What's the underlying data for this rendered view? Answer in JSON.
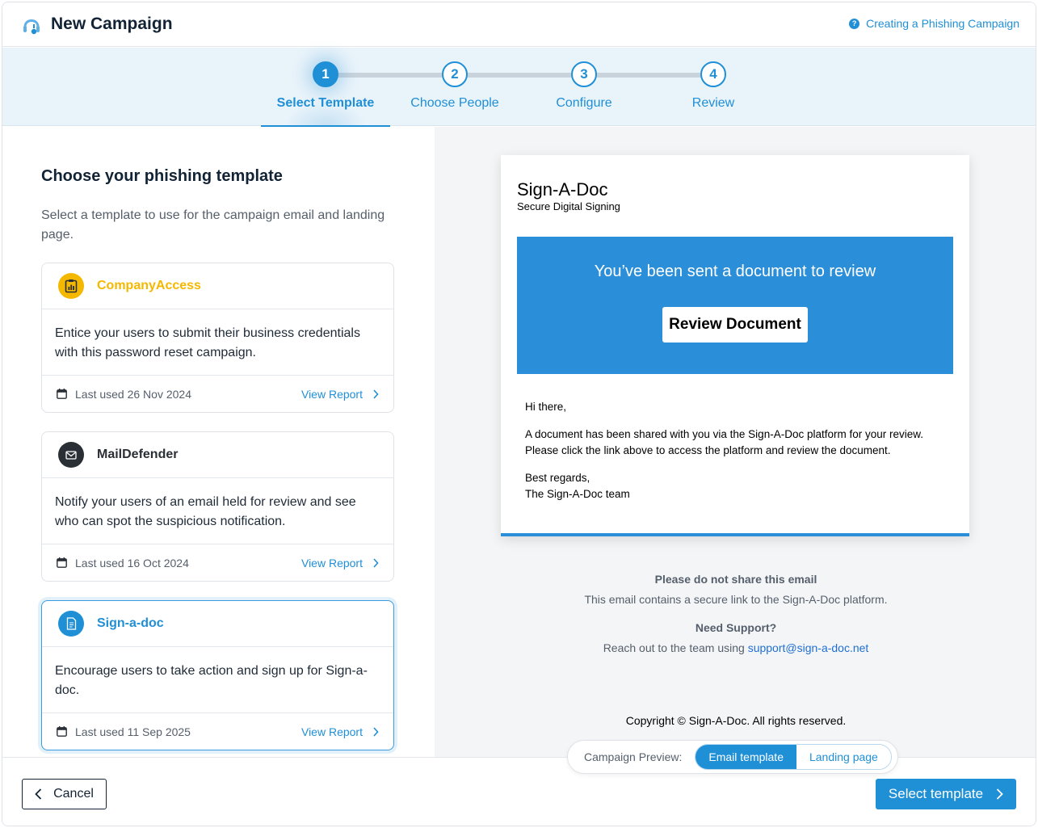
{
  "header": {
    "title": "New Campaign",
    "help_link": "Creating a Phishing Campaign",
    "help_icon_glyph": "?"
  },
  "stepper": {
    "steps": [
      {
        "number": "1",
        "label": "Select Template",
        "active": true
      },
      {
        "number": "2",
        "label": "Choose People",
        "active": false
      },
      {
        "number": "3",
        "label": "Configure",
        "active": false
      },
      {
        "number": "4",
        "label": "Review",
        "active": false
      }
    ]
  },
  "left": {
    "heading": "Choose your phishing template",
    "subtitle": "Select a template to use for the campaign email and landing page.",
    "templates": [
      {
        "name": "CompanyAccess",
        "icon": "clipboard-chart-icon",
        "color": "#f5b800",
        "description": "Entice your users to submit their business credentials with this password reset campaign.",
        "last_used": "Last used 26 Nov 2024",
        "view_report": "View Report"
      },
      {
        "name": "MailDefender",
        "icon": "envelope-icon",
        "color": "#2a2f36",
        "description": "Notify your users of an email held for review and see who can spot the suspicious notification.",
        "last_used": "Last used 16 Oct 2024",
        "view_report": "View Report"
      },
      {
        "name": "Sign-a-doc",
        "icon": "document-icon",
        "color": "#1f8fd6",
        "description": "Encourage users to take action and sign up for Sign-a-doc.",
        "last_used": "Last used 11 Sep 2025",
        "view_report": "View Report"
      }
    ]
  },
  "preview": {
    "brand_name": "Sign-A-Doc",
    "brand_tagline": "Secure Digital Signing",
    "banner_text": "You’ve been sent a document to review",
    "button_label": "Review Document",
    "greeting": "Hi there,",
    "body": "A document has been shared with you via the Sign-A-Doc platform for your review. Please click the link above to access the platform and review the document.",
    "signoff_1": "Best regards,",
    "signoff_2": "The Sign-A-Doc team",
    "notice_title": "Please do not share this email",
    "notice_text": "This email contains a secure link to the Sign-A-Doc platform.",
    "support_title": "Need Support?",
    "support_text": "Reach out to the team using",
    "support_email": "support@sign-a-doc.net",
    "copyright": "Copyright © Sign-A-Doc. All rights reserved.",
    "accent_color": "#2b8ed8"
  },
  "preview_toggle": {
    "label": "Campaign Preview:",
    "options": [
      "Email template",
      "Landing page"
    ],
    "selected": "Email template"
  },
  "footer": {
    "cancel_label": "Cancel",
    "select_label": "Select template"
  }
}
